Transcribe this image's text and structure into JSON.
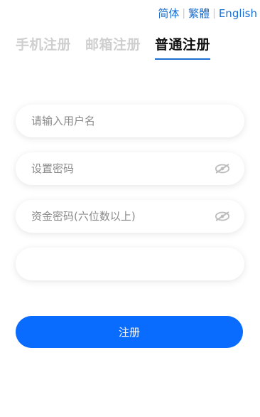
{
  "language": {
    "simplified": "简体",
    "traditional": "繁體",
    "english": "English",
    "separator": "|"
  },
  "tabs": [
    {
      "label": "手机注册",
      "active": false
    },
    {
      "label": "邮箱注册",
      "active": false
    },
    {
      "label": "普通注册",
      "active": true
    }
  ],
  "form": {
    "username_placeholder": "请输入用户名",
    "password_placeholder": "设置密码",
    "fund_password_placeholder": "资金密码(六位数以上)",
    "extra_value": ""
  },
  "submit_label": "注册",
  "colors": {
    "accent": "#0a6cff",
    "link": "#1a6fd1",
    "inactive_tab": "#cfcfcf"
  },
  "icons": {
    "password_toggle": "eye-slash-icon",
    "fund_password_toggle": "eye-slash-icon"
  }
}
